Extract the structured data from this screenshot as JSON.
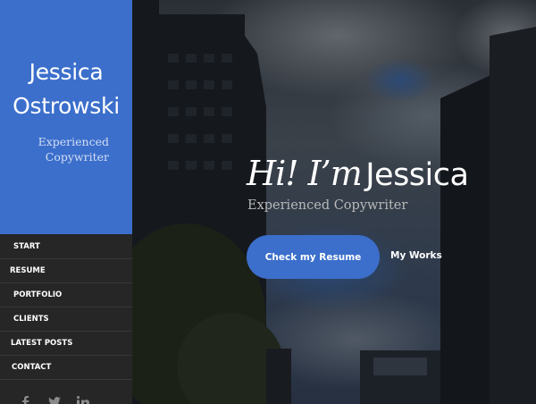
{
  "sidebar": {
    "brand": {
      "name_line1": "Jessica",
      "name_line2": "Ostrowski",
      "subtitle_line1": "Experienced",
      "subtitle_line2": "Copywriter",
      "color": "#3c6fcb"
    },
    "nav": {
      "start": "START",
      "resume": "RESUME",
      "portfolio": "PORTFOLIO",
      "clients": "CLIENTS",
      "latest_posts": "LATEST POSTS",
      "contact": "CONTACT"
    },
    "social_icons": [
      "facebook-icon",
      "twitter-icon",
      "linkedin-icon"
    ]
  },
  "hero": {
    "greeting_italic": "Hi! I’m",
    "greeting_name": "Jessica",
    "tagline": "Experienced Copywriter",
    "primary_button": "Check my Resume",
    "secondary_link": "My Works",
    "accent_color": "#3c6fcb"
  }
}
